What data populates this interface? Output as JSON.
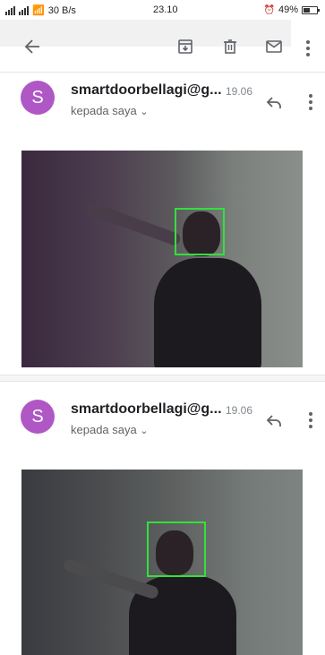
{
  "status_bar": {
    "network_speed": "30 B/s",
    "time": "23.10",
    "battery": "49%"
  },
  "toolbar": {
    "back_icon": "arrow-left-icon",
    "archive_icon": "archive-icon",
    "delete_icon": "trash-icon",
    "mark_unread_icon": "mail-icon",
    "more_icon": "more-vert-icon"
  },
  "messages": [
    {
      "avatar_letter": "S",
      "avatar_color": "#b057c6",
      "sender": "smartdoorbellagi@g...",
      "time": "19.06",
      "recipient": "kepada saya"
    },
    {
      "avatar_letter": "S",
      "avatar_color": "#b057c6",
      "sender": "smartdoorbellagi@g...",
      "time": "19.06",
      "recipient": "kepada saya"
    }
  ],
  "colors": {
    "face_box": "#32e13a",
    "icon": "#5f6368"
  }
}
